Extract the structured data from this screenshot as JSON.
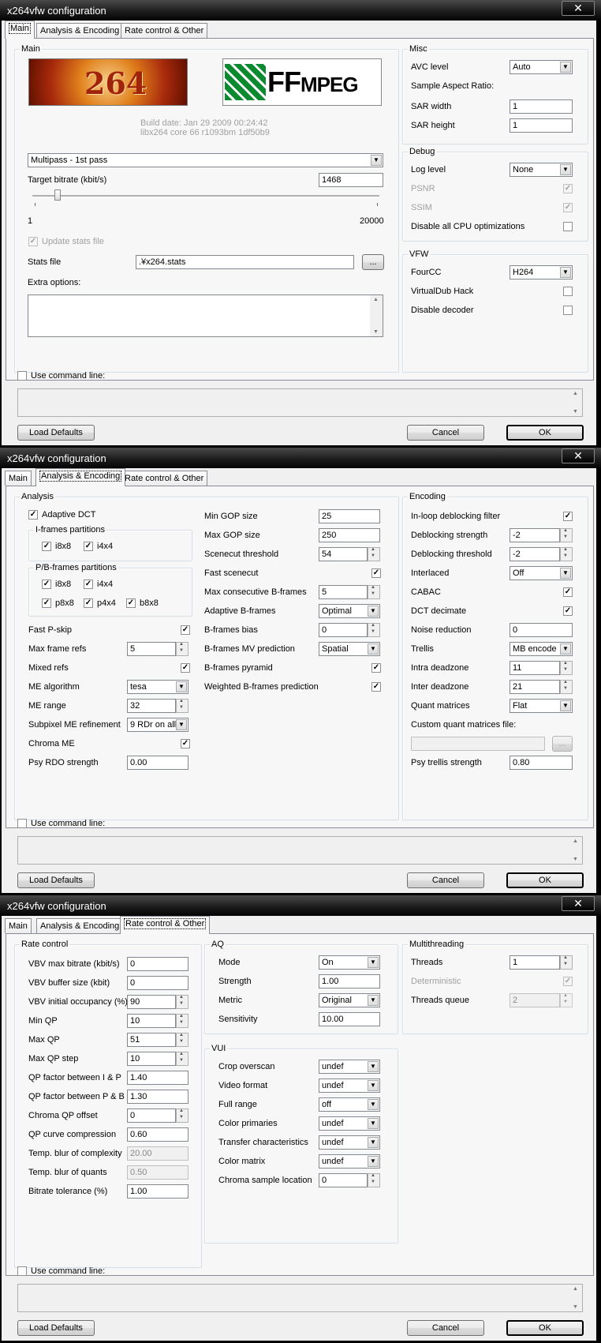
{
  "window_title": "x264vfw configuration",
  "close_glyph": "✕",
  "tabs": [
    "Main",
    "Analysis & Encoding",
    "Rate control & Other"
  ],
  "footer": {
    "use_cmd_label": "Use command line:",
    "load_defaults": "Load Defaults",
    "cancel": "Cancel",
    "ok": "OK"
  },
  "main": {
    "group_main": "Main",
    "logo_x264_text": "264",
    "logo_ffmpeg_text": "FF",
    "logo_ffmpeg_small": "MPEG",
    "build_date": "Build date: Jan 29 2009 00:24:42",
    "core": "libx264 core 66 r1093bm 1df50b9",
    "mode": "Multipass - 1st pass",
    "bitrate_label": "Target bitrate (kbit/s)",
    "bitrate_value": "1468",
    "slider_min": "1",
    "slider_max": "20000",
    "slider_level": 0.073,
    "update_stats_label": "Update stats file",
    "stats_file_label": "Stats file",
    "stats_file_value": ".¥x264.stats",
    "browse": "...",
    "extra_options_label": "Extra options:",
    "group_misc": "Misc",
    "avc_level_label": "AVC level",
    "avc_level": "Auto",
    "sar_label": "Sample Aspect Ratio:",
    "sar_width_label": "SAR width",
    "sar_width": "1",
    "sar_height_label": "SAR height",
    "sar_height": "1",
    "group_debug": "Debug",
    "log_level_label": "Log level",
    "log_level": "None",
    "psnr_label": "PSNR",
    "ssim_label": "SSIM",
    "disable_cpu_label": "Disable all CPU optimizations",
    "group_vfw": "VFW",
    "fourcc_label": "FourCC",
    "fourcc": "H264",
    "vdub_label": "VirtualDub Hack",
    "disable_decoder_label": "Disable decoder"
  },
  "analysis": {
    "group_analysis": "Analysis",
    "adaptive_dct": "Adaptive DCT",
    "iframes_partitions": "I-frames partitions",
    "i8x8": "i8x8",
    "i4x4": "i4x4",
    "pbframes_partitions": "P/B-frames partitions",
    "p8x8": "p8x8",
    "p4x4": "p4x4",
    "b8x8": "b8x8",
    "fast_pskip": "Fast P-skip",
    "max_frame_refs_label": "Max frame refs",
    "max_frame_refs": "5",
    "mixed_refs": "Mixed refs",
    "me_algorithm_label": "ME algorithm",
    "me_algorithm": "tesa",
    "me_range_label": "ME range",
    "me_range": "32",
    "subpixel_label": "Subpixel ME refinement",
    "subpixel": "9 RDr on all",
    "chroma_me": "Chroma ME",
    "psy_rdo_label": "Psy RDO strength",
    "psy_rdo": "0.00",
    "min_gop_label": "Min GOP size",
    "min_gop": "25",
    "max_gop_label": "Max GOP size",
    "max_gop": "250",
    "scenecut_label": "Scenecut threshold",
    "scenecut": "54",
    "fast_scenecut": "Fast scenecut",
    "max_bframes_label": "Max consecutive B-frames",
    "max_bframes": "5",
    "adaptive_b_label": "Adaptive B-frames",
    "adaptive_b": "Optimal",
    "bframes_bias_label": "B-frames bias",
    "bframes_bias": "0",
    "bframes_mv_label": "B-frames MV prediction",
    "bframes_mv": "Spatial",
    "bframes_pyramid": "B-frames pyramid",
    "weighted_b": "Weighted B-frames prediction",
    "group_encoding": "Encoding",
    "inloop": "In-loop deblocking filter",
    "deblock_strength_label": "Deblocking strength",
    "deblock_strength": "-2",
    "deblock_threshold_label": "Deblocking threshold",
    "deblock_threshold": "-2",
    "interlaced_label": "Interlaced",
    "interlaced": "Off",
    "cabac": "CABAC",
    "dct_decimate": "DCT decimate",
    "noise_reduction_label": "Noise reduction",
    "noise_reduction": "0",
    "trellis_label": "Trellis",
    "trellis": "MB encode",
    "intra_deadzone_label": "Intra deadzone",
    "intra_deadzone": "11",
    "inter_deadzone_label": "Inter deadzone",
    "inter_deadzone": "21",
    "quant_matrices_label": "Quant matrices",
    "quant_matrices": "Flat",
    "custom_quant_label": "Custom quant matrices file:",
    "browse": "...",
    "psy_trellis_label": "Psy trellis strength",
    "psy_trellis": "0.80"
  },
  "rate": {
    "group_rate": "Rate control",
    "vbv_max_label": "VBV max bitrate (kbit/s)",
    "vbv_max": "0",
    "vbv_buf_label": "VBV buffer size (kbit)",
    "vbv_buf": "0",
    "vbv_init_label": "VBV initial occupancy (%)",
    "vbv_init": "90",
    "min_qp_label": "Min QP",
    "min_qp": "10",
    "max_qp_label": "Max QP",
    "max_qp": "51",
    "max_qp_step_label": "Max QP step",
    "max_qp_step": "10",
    "qp_ip_label": "QP factor between I & P",
    "qp_ip": "1.40",
    "qp_pb_label": "QP factor between P & B",
    "qp_pb": "1.30",
    "chroma_qp_label": "Chroma QP offset",
    "chroma_qp": "0",
    "qp_curve_label": "QP curve compression",
    "qp_curve": "0.60",
    "blur_complexity_label": "Temp. blur of complexity",
    "blur_complexity": "20.00",
    "blur_quants_label": "Temp. blur of quants",
    "blur_quants": "0.50",
    "bitrate_tol_label": "Bitrate tolerance (%)",
    "bitrate_tol": "1.00",
    "group_aq": "AQ",
    "aq_mode_label": "Mode",
    "aq_mode": "On",
    "aq_strength_label": "Strength",
    "aq_strength": "1.00",
    "aq_metric_label": "Metric",
    "aq_metric": "Original",
    "aq_sensitivity_label": "Sensitivity",
    "aq_sensitivity": "10.00",
    "group_mt": "Multithreading",
    "threads_label": "Threads",
    "threads": "1",
    "deterministic_label": "Deterministic",
    "threads_queue_label": "Threads queue",
    "threads_queue": "2",
    "group_vui": "VUI",
    "crop_label": "Crop overscan",
    "crop": "undef",
    "video_format_label": "Video format",
    "video_format": "undef",
    "full_range_label": "Full range",
    "full_range": "off",
    "color_prim_label": "Color primaries",
    "color_prim": "undef",
    "transfer_label": "Transfer characteristics",
    "transfer": "undef",
    "color_matrix_label": "Color matrix",
    "color_matrix": "undef",
    "chroma_loc_label": "Chroma sample location",
    "chroma_loc": "0"
  }
}
